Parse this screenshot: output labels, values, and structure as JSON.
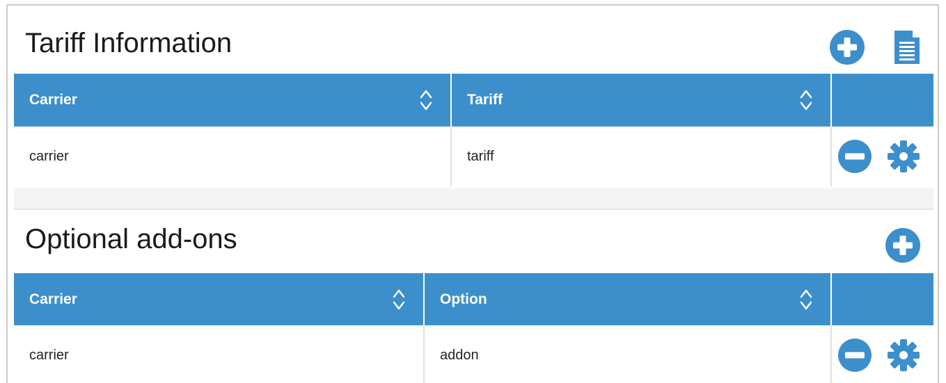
{
  "tariff_panel": {
    "title": "Tariff Information",
    "columns": [
      "Carrier",
      "Tariff",
      ""
    ],
    "rows": [
      {
        "carrier": "carrier",
        "tariff": "tariff"
      }
    ]
  },
  "addons_panel": {
    "title": "Optional add-ons",
    "columns": [
      "Carrier",
      "Option",
      ""
    ],
    "rows": [
      {
        "carrier": "carrier",
        "option": "addon"
      }
    ]
  },
  "icons": {
    "add": "plus-circle-icon",
    "document": "document-icon",
    "remove": "minus-circle-icon",
    "settings": "gear-icon",
    "sort": "sort-updown-icon"
  },
  "colors": {
    "header_blue": "#3d8fcc",
    "icon_blue": "#3d8fcc"
  }
}
